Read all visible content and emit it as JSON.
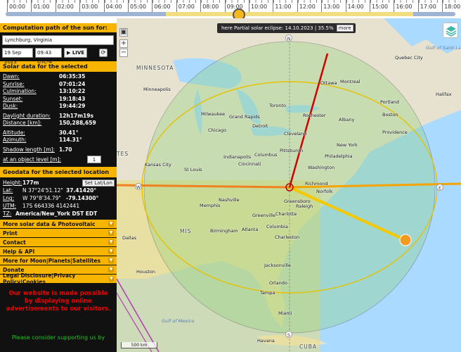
{
  "timeline": {
    "hours": [
      "00:00",
      "01:00",
      "02:00",
      "03:00",
      "04:00",
      "05:00",
      "06:00",
      "07:00",
      "08:00",
      "09:00",
      "10:00",
      "11:00",
      "12:00",
      "13:00",
      "14:00",
      "15:00",
      "16:00",
      "17:00",
      "18:00"
    ]
  },
  "eclipse": {
    "text": "here Partial solar eclipse: 14.10.2023 | 35.5%",
    "more_label": "more"
  },
  "panel": {
    "header": "Computation path of the sun for:",
    "location": "Lynchburg, Virginia",
    "date": "19 Sep 2023",
    "time": "09:43 UTC-4",
    "live_label": "LIVE",
    "solar_header": "Solar data for the selected location",
    "solar": [
      {
        "label": "Dawn:",
        "value": "06:35:35",
        "link": true
      },
      {
        "label": "Sunrise:",
        "value": "07:01:24",
        "link": true
      },
      {
        "label": "Culmination:",
        "value": "13:10:22",
        "link": true
      },
      {
        "label": "Sunset:",
        "value": "19:18:43",
        "link": true
      },
      {
        "label": "Dusk:",
        "value": "19:44:29",
        "link": true
      }
    ],
    "solar2": [
      {
        "label": "Daylight duration:",
        "value": "12h17m19s"
      },
      {
        "label": "Distance [km]:",
        "value": "150,288,659"
      }
    ],
    "solar3": [
      {
        "label": "Altitude:",
        "value": "30.41°"
      },
      {
        "label": "Azimuth:",
        "value": "114.31°"
      }
    ],
    "shadow_label": "Shadow length [m]:",
    "shadow_value": "1.70",
    "object_label": "at an object level [m]:",
    "object_value": "1",
    "geo_header": "Geodata for the selected location",
    "height_label": "Height:",
    "height_value": "177m",
    "setlatlon_label": "Set Lat/Lon",
    "lat_label": "Lat:",
    "lat_dms": "N 37°24'51.12\"",
    "lat_dec": "37.41420°",
    "lng_label": "Lng:",
    "lng_dms": "W 79°8'34.79\"",
    "lng_dec": "-79.14300°",
    "utm_label": "UTM:",
    "utm_value": "17S 664336 4142441",
    "tz_label": "TZ:",
    "tz_value": "America/New_York DST EDT",
    "menu": [
      "More solar data & Photovoltaic",
      "Print",
      "Contact",
      "Help & API",
      "More for Moon|Planets|Satellites",
      "Donate",
      "Legal Disclosure|Privacy Policy|Cookies"
    ],
    "support_text": "Our website is made possible by displaying online advertisements to our visitors.",
    "consider_text": "Please consider supporting us by"
  },
  "map": {
    "scale": "500 km",
    "directions": {
      "n": "N",
      "e": "E",
      "w": "W",
      "s": "S"
    },
    "labels": {
      "ottawa": "Ottawa",
      "montreal": "Montreal",
      "toronto": "Toronto",
      "milwaukee": "Milwaukee",
      "grand_rapids": "Grand Rapids",
      "detroit": "Detroit",
      "chicago": "Chicago",
      "cleveland": "Cleveland",
      "rochester": "Rochester",
      "albany": "Albany",
      "boston": "Boston",
      "providence": "Providence",
      "new_york": "New York",
      "philadelphia": "Philadelphia",
      "pittsburgh": "Pittsburgh",
      "columbus": "Columbus",
      "indianapolis": "Indianapolis",
      "cincinnati": "Cincinnati",
      "washington": "Washington",
      "richmond": "Richmond",
      "norfolk": "Norfolk",
      "st_louis": "St Louis",
      "kansas_city": "Kansas City",
      "nashville": "Nashville",
      "greensboro": "Greensboro",
      "raleigh": "Raleigh",
      "charlotte": "Charlotte",
      "memphis": "Memphis",
      "atlanta": "Atlanta",
      "birmingham": "Birmingham",
      "columbia": "Columbia",
      "greenville": "Greenville",
      "charleston": "Charleston",
      "dallas": "Dallas",
      "houston": "Houston",
      "jacksonville": "Jacksonville",
      "tampa": "Tampa",
      "orlando": "Orlando",
      "miami": "Miami",
      "havana": "Havana",
      "minneapolis": "Minneapolis",
      "minnesota": "MINNESOTA",
      "quebec": "Quebec City",
      "halifax": "Halifax",
      "portland": "Portland",
      "gulf": "Gulf of Saint Lawrence",
      "gulf_mexico": "Gulf of Mexico",
      "cuba": "CUBA",
      "tes": "TES",
      "mis": "MIS"
    }
  }
}
